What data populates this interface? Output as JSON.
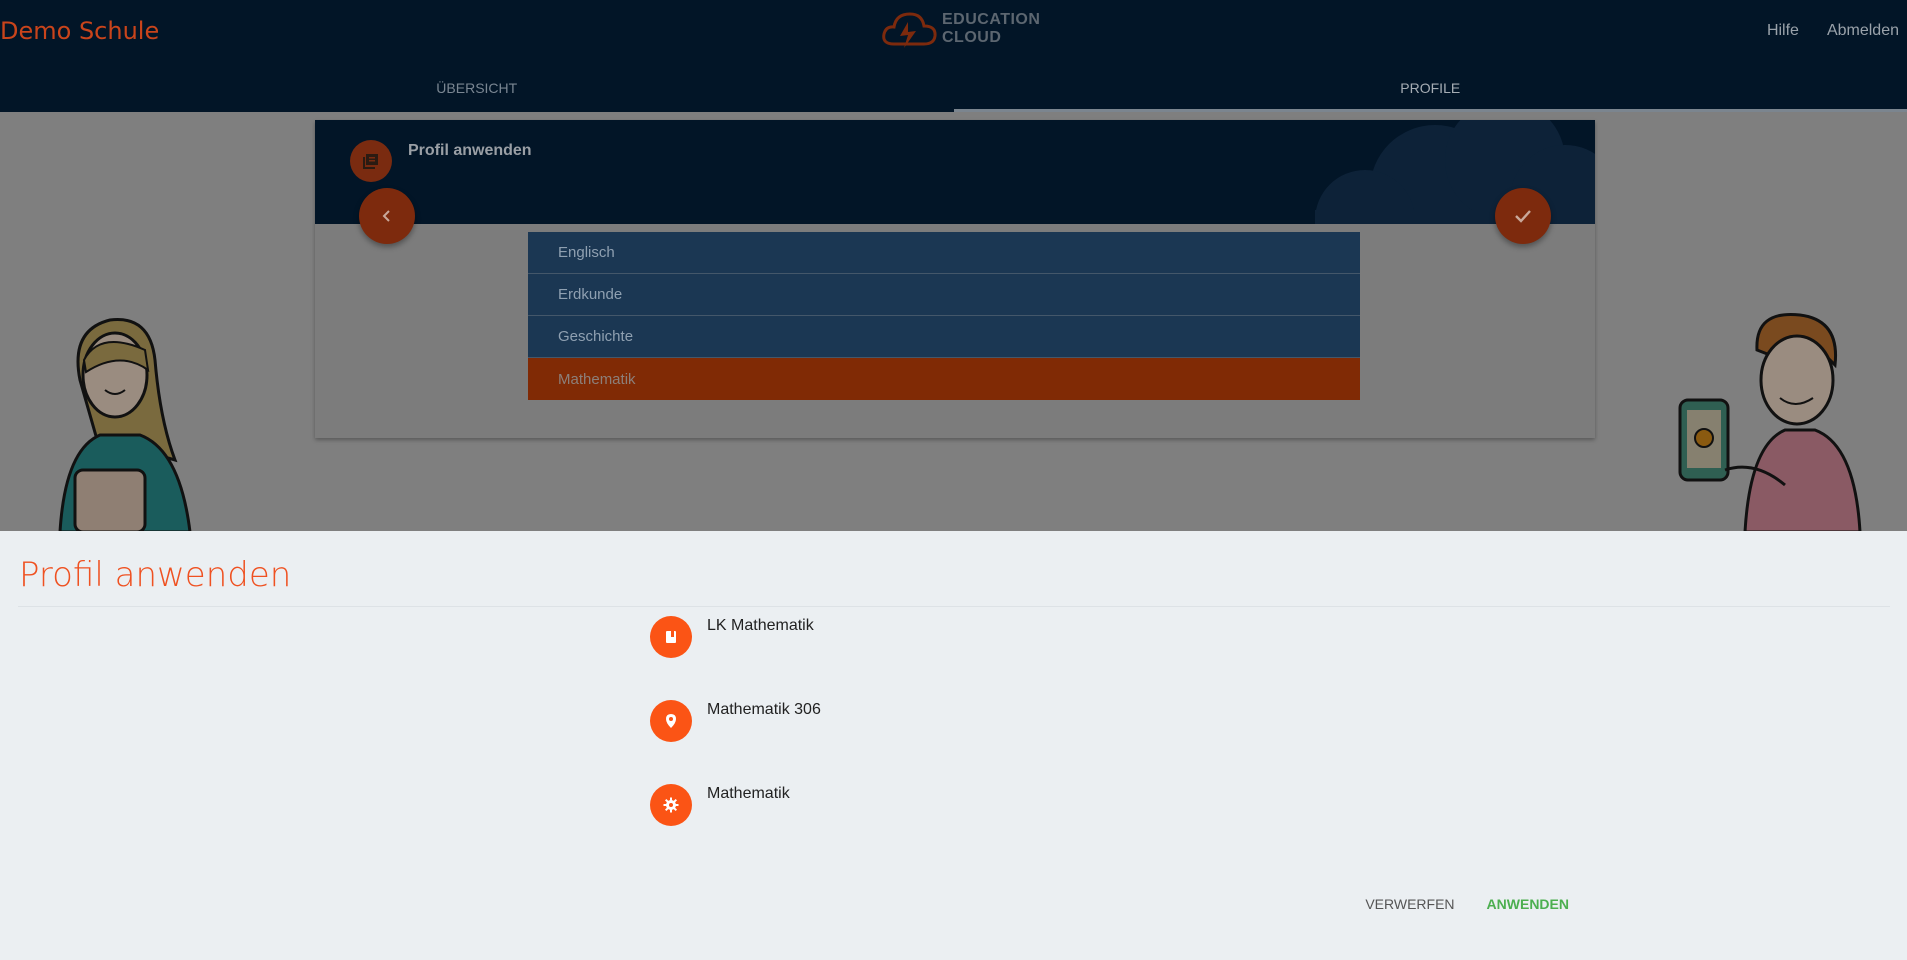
{
  "header": {
    "brand": "Demo Schule",
    "logo_line1": "EDUCATION",
    "logo_line2": "CLOUD",
    "nav": {
      "help": "Hilfe",
      "logout": "Abmelden"
    },
    "tabs": [
      {
        "label": "ÜBERSICHT",
        "active": false
      },
      {
        "label": "PROFILE",
        "active": true
      }
    ]
  },
  "card": {
    "title": "Profil anwenden",
    "subjects": [
      {
        "label": "Englisch",
        "selected": false
      },
      {
        "label": "Erdkunde",
        "selected": false
      },
      {
        "label": "Geschichte",
        "selected": false
      },
      {
        "label": "Mathematik",
        "selected": true
      }
    ]
  },
  "sheet": {
    "title": "Profil anwenden",
    "items": [
      {
        "icon": "book-icon",
        "label": "LK Mathematik"
      },
      {
        "icon": "location-pin-icon",
        "label": "Mathematik 306"
      },
      {
        "icon": "gear-icon",
        "label": "Mathematik"
      }
    ],
    "discard_label": "VERWERFEN",
    "apply_label": "ANWENDEN"
  },
  "colors": {
    "header_bg": "#021527",
    "accent": "#fb5415",
    "apply_green": "#4caf50",
    "sheet_bg": "#ebeff2"
  }
}
